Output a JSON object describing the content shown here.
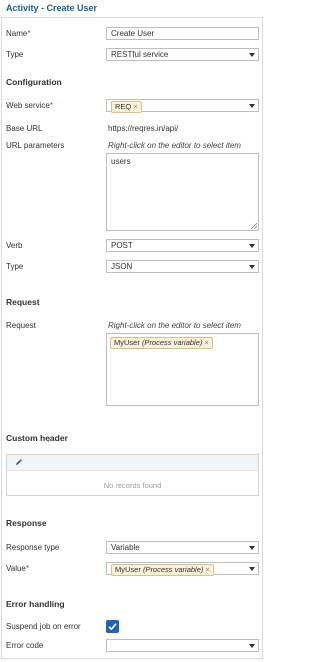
{
  "header": {
    "title": "Activity - Create User"
  },
  "general": {
    "name_label": "Name",
    "name_value": "Create User",
    "type_label": "Type",
    "type_value": "RESTful service"
  },
  "configuration": {
    "section_title": "Configuration",
    "web_service_label": "Web service",
    "web_service_chip": "REQ",
    "base_url_label": "Base URL",
    "base_url_value": "https://reqres.in/api/",
    "url_params_label": "URL parameters",
    "url_params_hint": "Right-click on the editor to select item",
    "url_params_value": "users",
    "verb_label": "Verb",
    "verb_value": "POST",
    "type_label": "Type",
    "type_value": "JSON"
  },
  "request": {
    "section_title": "Request",
    "request_label": "Request",
    "request_hint": "Right-click on the editor to select item",
    "chip_name": "MyUser",
    "chip_kind": "(Process variable)"
  },
  "custom_header": {
    "section_title": "Custom header",
    "empty_text": "No records found"
  },
  "response": {
    "section_title": "Response",
    "response_type_label": "Response type",
    "response_type_value": "Variable",
    "value_label": "Value",
    "chip_name": "MyUser",
    "chip_kind": "(Process variable)"
  },
  "error_handling": {
    "section_title": "Error handling",
    "suspend_label": "Suspend job on error",
    "suspend_checked": true,
    "error_code_label": "Error code",
    "error_code_value": ""
  },
  "colors": {
    "accent": "#1f5e9a",
    "checkbox": "#1e64b4",
    "chip_bg": "#faf1d9",
    "required": "#c0392b"
  }
}
